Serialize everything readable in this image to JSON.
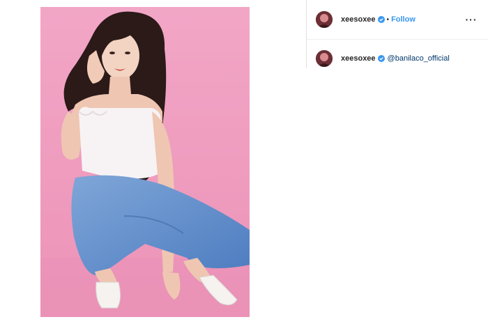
{
  "post": {
    "image_description_icon": "photo",
    "author": {
      "username": "xeesoxee",
      "verified_icon": "verified-badge-icon",
      "separator": "•",
      "follow_label": "Follow"
    },
    "more_icon": "more-options-icon",
    "more_glyph": "···",
    "caption": {
      "username": "xeesoxee",
      "mention": "@banilaco_official"
    }
  },
  "colors": {
    "link_blue": "#3897f0",
    "mention_blue": "#00376b",
    "photo_background": "#ef9cbf"
  }
}
